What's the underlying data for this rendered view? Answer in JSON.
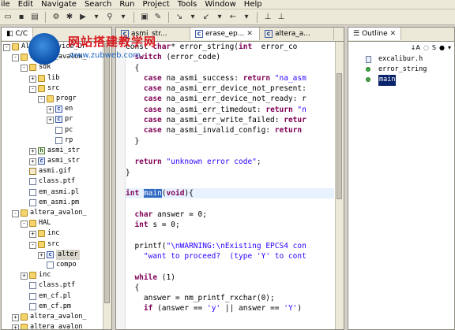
{
  "menu": [
    "ile",
    "Edit",
    "Navigate",
    "Search",
    "Run",
    "Project",
    "Tools",
    "Window",
    "Help"
  ],
  "watermark": {
    "title": "网站搭建教学网",
    "url": "www.zubweb.com"
  },
  "left_pane": {
    "tab_label": "C/C",
    "rows": [
      {
        "depth": 0,
        "twisty": "-",
        "icon": "folder",
        "label": "Altera_Device_Dr"
      },
      {
        "depth": 1,
        "twisty": "-",
        "icon": "folder",
        "label": "altera_avalon_"
      },
      {
        "depth": 2,
        "twisty": "-",
        "icon": "folder",
        "label": "sdk"
      },
      {
        "depth": 3,
        "twisty": "+",
        "icon": "folder",
        "label": "lib"
      },
      {
        "depth": 3,
        "twisty": "-",
        "icon": "folder",
        "label": "src"
      },
      {
        "depth": 4,
        "twisty": "-",
        "icon": "folder",
        "label": "progr"
      },
      {
        "depth": 5,
        "twisty": "+",
        "icon": "c",
        "label": "en"
      },
      {
        "depth": 5,
        "twisty": "+",
        "icon": "c",
        "label": "pr"
      },
      {
        "depth": 5,
        "twisty": "",
        "icon": "file",
        "label": "pc"
      },
      {
        "depth": 5,
        "twisty": "",
        "icon": "file",
        "label": "rp"
      },
      {
        "depth": 3,
        "twisty": "+",
        "icon": "h",
        "label": "asmi_str"
      },
      {
        "depth": 3,
        "twisty": "+",
        "icon": "c",
        "label": "asmi_str"
      },
      {
        "depth": 2,
        "twisty": "",
        "icon": "gif",
        "label": "asmi.gif"
      },
      {
        "depth": 2,
        "twisty": "",
        "icon": "file",
        "label": "class.ptf"
      },
      {
        "depth": 2,
        "twisty": "",
        "icon": "file",
        "label": "em_asmi.pl"
      },
      {
        "depth": 2,
        "twisty": "",
        "icon": "file",
        "label": "em_asmi.pm"
      },
      {
        "depth": 1,
        "twisty": "-",
        "icon": "folder",
        "label": "altera_avalon_"
      },
      {
        "depth": 2,
        "twisty": "-",
        "icon": "folder",
        "label": "HAL"
      },
      {
        "depth": 3,
        "twisty": "+",
        "icon": "folder",
        "label": "inc"
      },
      {
        "depth": 3,
        "twisty": "-",
        "icon": "folder",
        "label": "src"
      },
      {
        "depth": 4,
        "twisty": "+",
        "icon": "c",
        "label": "alter",
        "selected": true
      },
      {
        "depth": 4,
        "twisty": "",
        "icon": "file",
        "label": "compo"
      },
      {
        "depth": 2,
        "twisty": "+",
        "icon": "folder",
        "label": "inc"
      },
      {
        "depth": 2,
        "twisty": "",
        "icon": "file",
        "label": "class.ptf"
      },
      {
        "depth": 2,
        "twisty": "",
        "icon": "file",
        "label": "em_cf.pl"
      },
      {
        "depth": 2,
        "twisty": "",
        "icon": "file",
        "label": "em_cf.pm"
      },
      {
        "depth": 1,
        "twisty": "+",
        "icon": "folder",
        "label": "altera_avalon_"
      },
      {
        "depth": 1,
        "twisty": "+",
        "icon": "folder",
        "label": "altera_avalon_"
      }
    ]
  },
  "editor": {
    "tabs": [
      {
        "label": "asmi_str...",
        "active": false,
        "closable": false
      },
      {
        "label": "erase_ep...",
        "active": true,
        "closable": true
      },
      {
        "label": "altera_a...",
        "active": false,
        "closable": false
      }
    ],
    "lines": [
      [
        [
          "",
          "const "
        ],
        [
          "kw",
          "char"
        ],
        [
          "",
          "* error_string("
        ],
        [
          "kw",
          "int"
        ],
        [
          "",
          "  error_co"
        ]
      ],
      [
        [
          "",
          "  "
        ],
        [
          "kw",
          "switch"
        ],
        [
          "",
          " (error_code)"
        ]
      ],
      [
        [
          "",
          "  {"
        ]
      ],
      [
        [
          "",
          "    "
        ],
        [
          "kw",
          "case"
        ],
        [
          "",
          " na_asmi_success: "
        ],
        [
          "kw",
          "return"
        ],
        [
          "",
          " "
        ],
        [
          "str",
          "\"na_asm"
        ]
      ],
      [
        [
          "",
          "    "
        ],
        [
          "kw",
          "case"
        ],
        [
          "",
          " na_asmi_err_device_not_present: "
        ]
      ],
      [
        [
          "",
          "    "
        ],
        [
          "kw",
          "case"
        ],
        [
          "",
          " na_asmi_err_device_not_ready: r"
        ]
      ],
      [
        [
          "",
          "    "
        ],
        [
          "kw",
          "case"
        ],
        [
          "",
          " na_asmi_err_timedout: "
        ],
        [
          "kw",
          "return"
        ],
        [
          "",
          " "
        ],
        [
          "str",
          "\"n"
        ]
      ],
      [
        [
          "",
          "    "
        ],
        [
          "kw",
          "case"
        ],
        [
          "",
          " na_asmi_err_write_failed: "
        ],
        [
          "kw",
          "retur"
        ]
      ],
      [
        [
          "",
          "    "
        ],
        [
          "kw",
          "case"
        ],
        [
          "",
          " na_asmi_invalid_config: "
        ],
        [
          "kw",
          "return"
        ]
      ],
      [
        [
          "",
          "  }"
        ]
      ],
      [
        [
          "",
          " "
        ]
      ],
      [
        [
          "",
          "  "
        ],
        [
          "kw",
          "return"
        ],
        [
          "",
          " "
        ],
        [
          "str",
          "\"unknown error code\""
        ],
        [
          "",
          ";"
        ]
      ],
      [
        [
          "",
          "}"
        ]
      ],
      [
        [
          "",
          " "
        ]
      ],
      [
        [
          "kw",
          "int"
        ],
        [
          "",
          " "
        ],
        [
          "sel",
          "main"
        ],
        [
          "",
          "("
        ],
        [
          "kw",
          "void"
        ],
        [
          "",
          ")"
        ],
        [
          "",
          "{"
        ]
      ],
      [
        [
          "",
          " "
        ]
      ],
      [
        [
          "",
          "  "
        ],
        [
          "kw",
          "char"
        ],
        [
          "",
          " answer = 0;"
        ]
      ],
      [
        [
          "",
          "  "
        ],
        [
          "kw",
          "int"
        ],
        [
          "",
          " s = 0;"
        ]
      ],
      [
        [
          "",
          " "
        ]
      ],
      [
        [
          "",
          "  printf("
        ],
        [
          "str",
          "\"\\nWARNING:\\nExisting EPCS4 con"
        ]
      ],
      [
        [
          "",
          "    "
        ],
        [
          "str",
          "\"want to proceed?  (type 'Y' to cont"
        ]
      ],
      [
        [
          "",
          " "
        ]
      ],
      [
        [
          "",
          "  "
        ],
        [
          "kw",
          "while"
        ],
        [
          "",
          " (1)"
        ]
      ],
      [
        [
          "",
          "  {"
        ]
      ],
      [
        [
          "",
          "    answer = nm_printf_rxchar(0);"
        ]
      ],
      [
        [
          "",
          "    "
        ],
        [
          "kw",
          "if"
        ],
        [
          "",
          " (answer == "
        ],
        [
          "str",
          "'y'"
        ],
        [
          "",
          " || answer == "
        ],
        [
          "str",
          "'Y'"
        ],
        [
          "",
          ")"
        ]
      ]
    ]
  },
  "outline": {
    "tab_label": "Outline",
    "items": [
      {
        "icon": "file-icon",
        "label": "excalibur.h"
      },
      {
        "icon": "function-icon",
        "label": "error_string"
      },
      {
        "icon": "function-icon",
        "label": "main",
        "selected": true
      }
    ]
  }
}
